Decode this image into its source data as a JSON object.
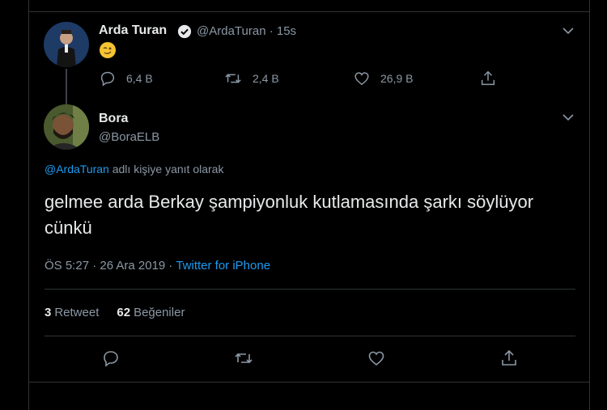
{
  "parent_tweet": {
    "author_name": "Arda Turan",
    "handle_time": "@ArdaTuran · 15s",
    "emoji": "😉",
    "actions": {
      "replies": "6,4 B",
      "retweets": "2,4 B",
      "likes": "26,9 B"
    }
  },
  "main_tweet": {
    "author_name": "Bora",
    "handle": "@BoraELB",
    "reply_to_mention": "@ArdaTuran",
    "reply_to_suffix": " adlı kişiye yanıt olarak",
    "text": "gelmee arda Berkay şampiyonluk kutlamasında şarkı söylüyor cünkü",
    "timestamp": "ÖS 5:27 · 26 Ara 2019 · ",
    "source": "Twitter for iPhone",
    "retweet_count": "3",
    "retweet_label": "Retweet",
    "like_count": "62",
    "like_label": "Beğeniler"
  },
  "colors": {
    "background": "#000000",
    "accent": "#1d9bf0",
    "muted": "#8b98a5",
    "border": "#2f3336"
  },
  "icons": [
    "verified-icon",
    "chevron-down-icon",
    "reply-icon",
    "retweet-icon",
    "like-icon",
    "share-icon"
  ]
}
